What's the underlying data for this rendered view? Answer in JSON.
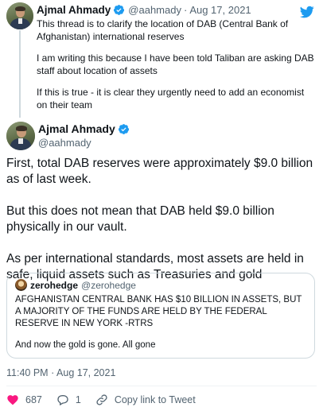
{
  "parent_tweet": {
    "author_name": "Ajmal Ahmady",
    "handle": "@aahmady",
    "separator": "·",
    "date": "Aug 17, 2021",
    "paragraphs": [
      "This thread is to clarify the location of DAB (Central Bank of Afghanistan) international reserves",
      "I am writing this because I have been told Taliban are asking DAB staff about location of assets",
      "If this is true - it is clear they urgently need to add an economist on their team"
    ]
  },
  "main_tweet": {
    "author_name": "Ajmal Ahmady",
    "handle": "@aahmady",
    "paragraphs": [
      "First, total DAB reserves were approximately $9.0 billion as of last week.",
      "But this does not mean that DAB held $9.0 billion physically in our vault.",
      "As per international standards, most assets are held in safe, liquid assets such as Treasuries and gold"
    ],
    "quoted": {
      "author_name": "zerohedge",
      "handle": "@zerohedge",
      "paragraphs": [
        "AFGHANISTAN CENTRAL BANK HAS $10 BILLION IN ASSETS, BUT A MAJORITY OF THE FUNDS ARE HELD BY THE FEDERAL RESERVE IN NEW YORK -RTRS",
        "And now the gold is gone. All gone"
      ]
    },
    "time": "11:40 PM",
    "separator": "·",
    "date": "Aug 17, 2021",
    "likes": "687",
    "replies": "1",
    "copy_link_label": "Copy link to Tweet"
  },
  "colors": {
    "twitter_blue": "#1d9bf0",
    "text": "#0f1419",
    "secondary_text": "#536471",
    "like_red": "#f91880",
    "border": "#cfd9de"
  },
  "icons": [
    "twitter-bird-icon",
    "verified-badge-icon",
    "heart-icon",
    "reply-icon",
    "link-icon"
  ]
}
